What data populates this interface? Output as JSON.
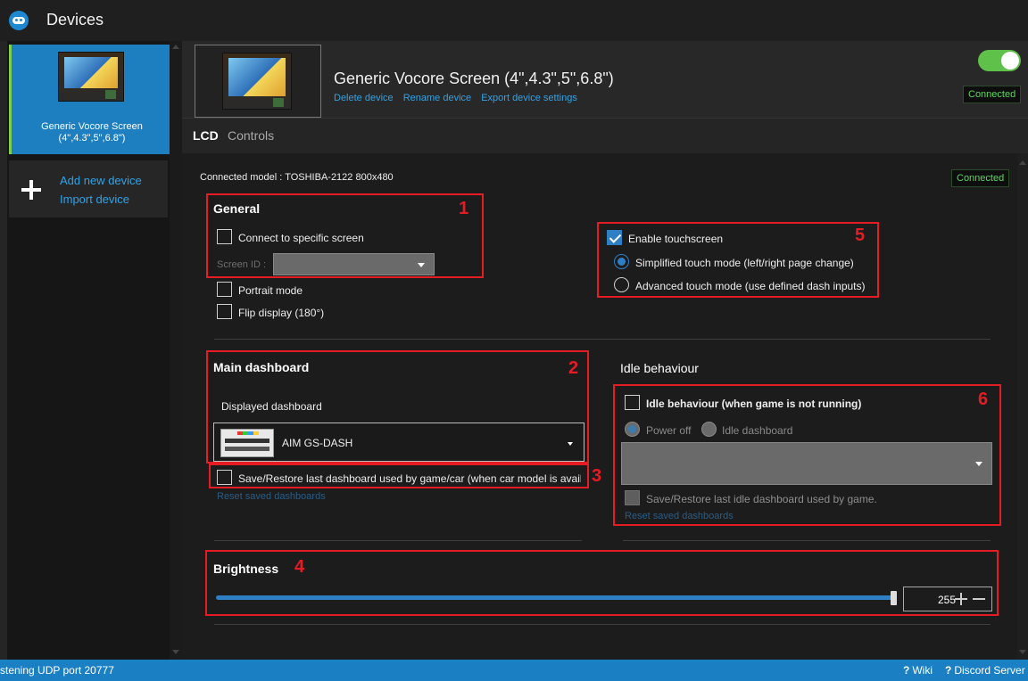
{
  "app": {
    "title": "Devices"
  },
  "sidebar": {
    "device_name": "Generic Vocore Screen",
    "device_sizes": "(4\",4.3\",5\",6.8\")",
    "add_new_device": "Add new device",
    "import_device": "Import device"
  },
  "header": {
    "device_title": "Generic Vocore Screen (4\",4.3\",5\",6.8\")",
    "links": [
      "Delete device",
      "Rename device",
      "Export device settings"
    ],
    "status": "Connected",
    "toggle_on": true
  },
  "tabs": [
    "LCD",
    "Controls"
  ],
  "lcd": {
    "connected_model": "Connected model : TOSHIBA-2122 800x480",
    "status": "Connected",
    "general": {
      "title": "General",
      "connect_specific": "Connect to specific screen",
      "screen_id_label": "Screen ID :",
      "portrait_mode": "Portrait mode",
      "flip_display": "Flip display (180°)"
    },
    "touch": {
      "enable": "Enable touchscreen",
      "enable_checked": true,
      "simplified": "Simplified touch mode (left/right page change)",
      "advanced": "Advanced touch mode (use defined dash inputs)",
      "selected": "simplified"
    },
    "main_dashboard": {
      "title": "Main dashboard",
      "displayed_label": "Displayed dashboard",
      "selected": "AIM GS-DASH",
      "save_restore": "Save/Restore last dashboard used by game/car (when car model is avail:",
      "reset": "Reset saved dashboards"
    },
    "idle": {
      "title": "Idle behaviour",
      "checkbox": "Idle behaviour (when game is not running)",
      "power_off": "Power off",
      "idle_dashboard": "Idle dashboard",
      "save_restore": "Save/Restore last idle dashboard used by game.",
      "reset": "Reset saved dashboards"
    },
    "brightness": {
      "title": "Brightness",
      "value": "255",
      "max": 255,
      "level": 1.0
    }
  },
  "annotations": [
    "1",
    "2",
    "3",
    "4",
    "5",
    "6"
  ],
  "status_bar": {
    "left": "stening UDP port 20777",
    "wiki": "Wiki",
    "discord": "Discord Server",
    "help_glyph": "?"
  },
  "colors": {
    "accent": "#1d7fc0",
    "connected": "#5cd65c",
    "annotation": "#e51c23",
    "toggle": "#5fc04a"
  }
}
